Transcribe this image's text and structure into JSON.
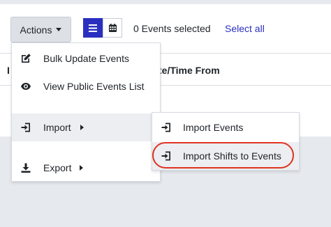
{
  "toolbar": {
    "actions_label": "Actions",
    "events_selected": "0 Events selected",
    "select_all": "Select all",
    "view_modes": [
      {
        "icon": "list-icon",
        "active": true
      },
      {
        "icon": "calendar-icon",
        "active": false
      }
    ]
  },
  "table": {
    "headers": [
      "I",
      "te/Time From"
    ]
  },
  "actions_menu": {
    "items": [
      {
        "label": "Bulk Update Events",
        "icon": "edit-icon"
      },
      {
        "label": "View Public Events List",
        "icon": "eye-icon"
      },
      {
        "label": "Import",
        "icon": "import-icon",
        "submenu": true
      },
      {
        "label": "Export",
        "icon": "download-icon",
        "submenu": true
      }
    ]
  },
  "import_submenu": {
    "items": [
      {
        "label": "Import Events",
        "icon": "import-icon"
      },
      {
        "label": "Import Shifts to Events",
        "icon": "import-icon",
        "highlighted": true
      }
    ]
  },
  "colors": {
    "accent": "#2b2fc0",
    "highlight_ring": "#e0321f",
    "hover_bg": "#eceef1",
    "page_bg": "#e6e9ee"
  }
}
